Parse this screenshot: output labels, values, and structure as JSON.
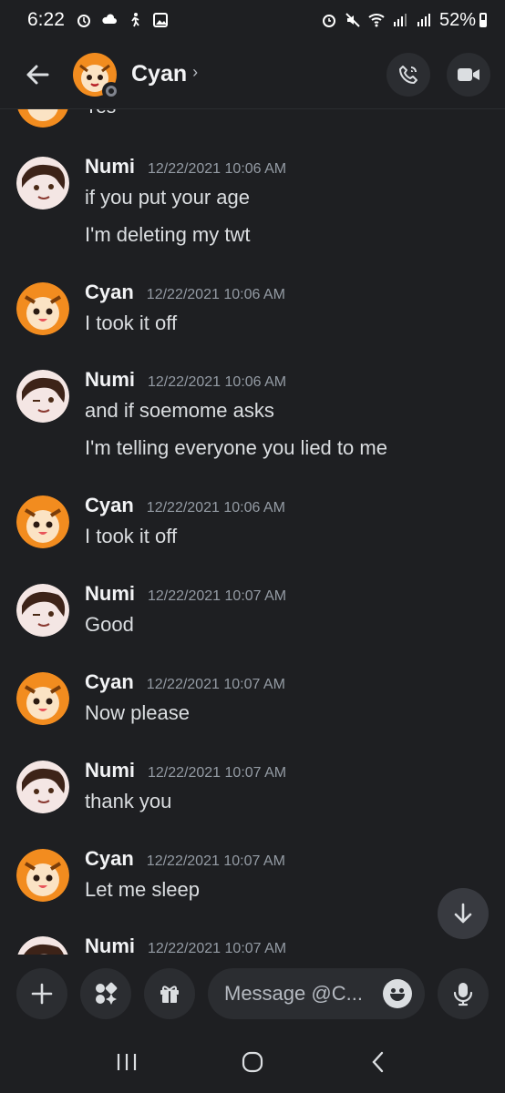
{
  "status_bar": {
    "time": "6:22",
    "battery": "52%"
  },
  "header": {
    "contact_name": "Cyan",
    "chevron": "›"
  },
  "partial_message": {
    "text": "Yes"
  },
  "messages": [
    {
      "author": "Numi",
      "timestamp": "12/22/2021 10:06 AM",
      "lines": [
        "if you put your age",
        "I'm deleting my twt"
      ]
    },
    {
      "author": "Cyan",
      "timestamp": "12/22/2021 10:06 AM",
      "lines": [
        "I took it off"
      ]
    },
    {
      "author": "Numi",
      "timestamp": "12/22/2021 10:06 AM",
      "lines": [
        "and if soemome asks",
        "I'm telling everyone you lied to me"
      ]
    },
    {
      "author": "Cyan",
      "timestamp": "12/22/2021 10:06 AM",
      "lines": [
        "I took it off"
      ]
    },
    {
      "author": "Numi",
      "timestamp": "12/22/2021 10:07 AM",
      "lines": [
        "Good"
      ]
    },
    {
      "author": "Cyan",
      "timestamp": "12/22/2021 10:07 AM",
      "lines": [
        "Now please"
      ]
    },
    {
      "author": "Numi",
      "timestamp": "12/22/2021 10:07 AM",
      "lines": [
        "thank you"
      ]
    },
    {
      "author": "Cyan",
      "timestamp": "12/22/2021 10:07 AM",
      "lines": [
        "Let me sleep"
      ]
    },
    {
      "author": "Numi",
      "timestamp": "12/22/2021 10:07 AM",
      "lines": []
    }
  ],
  "composer": {
    "placeholder": "Message @C..."
  },
  "icons": {
    "back": "arrow-left-icon",
    "call": "phone-icon",
    "video": "video-camera-icon",
    "scroll": "arrow-down-icon",
    "add": "plus-icon",
    "apps": "apps-sparkle-icon",
    "gift": "gift-icon",
    "emoji": "emoji-icon",
    "mic": "microphone-icon"
  },
  "colors": {
    "background": "#1e1f22",
    "surface": "#2b2d31",
    "text": "#dbdee1",
    "muted": "#949ba4"
  }
}
